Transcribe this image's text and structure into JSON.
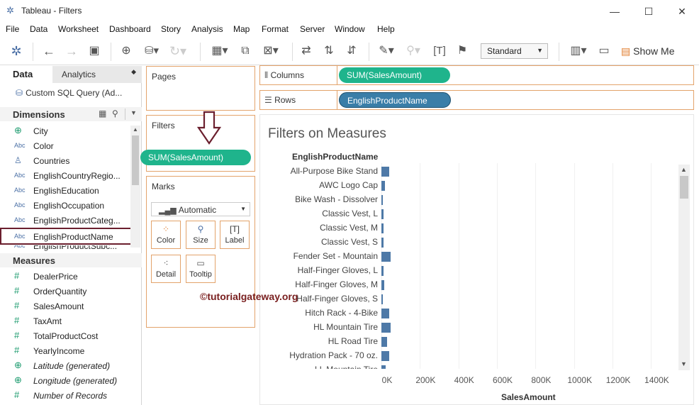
{
  "window": {
    "title": "Tableau - Filters",
    "controls": {
      "minimize": "—",
      "maximize": "☐",
      "close": "✕"
    }
  },
  "menu": [
    "File",
    "Data",
    "Worksheet",
    "Dashboard",
    "Story",
    "Analysis",
    "Map",
    "Format",
    "Server",
    "Window",
    "Help"
  ],
  "toolbar": {
    "fit_select": "Standard",
    "show_me": "Show Me"
  },
  "data_pane": {
    "tabs": {
      "data": "Data",
      "analytics": "Analytics"
    },
    "datasource": "Custom SQL Query (Ad...",
    "dimensions_label": "Dimensions",
    "dimensions": [
      {
        "icon": "globe-icon",
        "type": "geo",
        "name": "City"
      },
      {
        "icon": "abc-icon",
        "type": "Abc",
        "name": "Color"
      },
      {
        "icon": "hierarchy-icon",
        "type": "hier",
        "name": "Countries"
      },
      {
        "icon": "abc-icon",
        "type": "Abc",
        "name": "EnglishCountryRegio..."
      },
      {
        "icon": "abc-icon",
        "type": "Abc",
        "name": "EnglishEducation"
      },
      {
        "icon": "abc-icon",
        "type": "Abc",
        "name": "EnglishOccupation"
      },
      {
        "icon": "abc-icon",
        "type": "Abc",
        "name": "EnglishProductCateg..."
      },
      {
        "icon": "abc-icon",
        "type": "Abc",
        "name": "EnglishProductName"
      },
      {
        "icon": "abc-icon",
        "type": "Abc",
        "name": "EnglishProductSubc..."
      }
    ],
    "measures_label": "Measures",
    "measures": [
      {
        "icon": "hash-icon",
        "name": "DealerPrice",
        "italic": false
      },
      {
        "icon": "hash-icon",
        "name": "OrderQuantity",
        "italic": false
      },
      {
        "icon": "hash-icon",
        "name": "SalesAmount",
        "italic": false
      },
      {
        "icon": "hash-icon",
        "name": "TaxAmt",
        "italic": false
      },
      {
        "icon": "hash-icon",
        "name": "TotalProductCost",
        "italic": false
      },
      {
        "icon": "hash-icon",
        "name": "YearlyIncome",
        "italic": false
      },
      {
        "icon": "globe-icon",
        "name": "Latitude (generated)",
        "italic": true
      },
      {
        "icon": "globe-icon",
        "name": "Longitude (generated)",
        "italic": true
      },
      {
        "icon": "hash-icon",
        "name": "Number of Records",
        "italic": true
      }
    ]
  },
  "cards": {
    "pages": "Pages",
    "filters": "Filters",
    "filter_pill": "SUM(SalesAmount)",
    "marks": "Marks",
    "mark_type": "Automatic",
    "mark_buttons": [
      "Color",
      "Size",
      "Label",
      "Detail",
      "Tooltip"
    ]
  },
  "shelves": {
    "columns": "Columns",
    "columns_pill": "SUM(SalesAmount)",
    "rows": "Rows",
    "rows_pill": "EnglishProductName"
  },
  "view": {
    "title": "Filters on Measures"
  },
  "watermark": "©tutorialgateway.org",
  "chart_data": {
    "type": "bar",
    "orientation": "horizontal",
    "title": "Filters on Measures",
    "row_header": "EnglishProductName",
    "xlabel": "SalesAmount",
    "xlim": [
      0,
      1450000
    ],
    "ticks": [
      "0K",
      "200K",
      "400K",
      "600K",
      "800K",
      "1000K",
      "1200K",
      "1400K"
    ],
    "tick_values": [
      0,
      200000,
      400000,
      600000,
      800000,
      1000000,
      1200000,
      1400000
    ],
    "categories": [
      "All-Purpose Bike Stand",
      "AWC Logo Cap",
      "Bike Wash - Dissolver",
      "Classic Vest, L",
      "Classic Vest, M",
      "Classic Vest, S",
      "Fender Set - Mountain",
      "Half-Finger Gloves, L",
      "Half-Finger Gloves, M",
      "Half-Finger Gloves, S",
      "Hitch Rack - 4-Bike",
      "HL Mountain Tire",
      "HL Road Tire",
      "Hydration Pack - 70 oz.",
      "LL Mountain Tire"
    ],
    "values": [
      39591,
      19689,
      7219,
      12839,
      11477,
      12762,
      46619,
      9784,
      15090,
      9142,
      39360,
      48860,
      27971,
      40308,
      22000
    ],
    "grid": true
  }
}
